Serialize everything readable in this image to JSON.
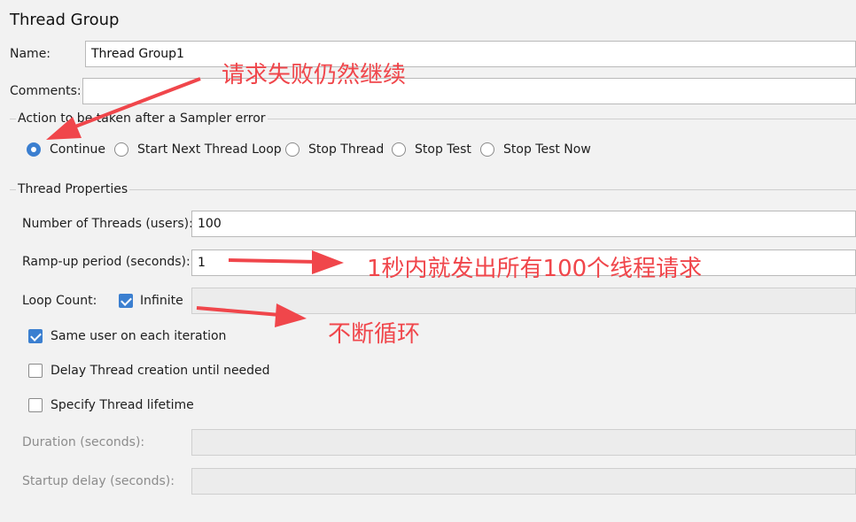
{
  "title": "Thread Group",
  "name": {
    "label": "Name:",
    "value": "Thread Group1"
  },
  "comments": {
    "label": "Comments:",
    "value": ""
  },
  "sampler_error": {
    "group_title": "Action to be taken after a Sampler error",
    "options": [
      "Continue",
      "Start Next Thread Loop",
      "Stop Thread",
      "Stop Test",
      "Stop Test Now"
    ],
    "selected": "Continue"
  },
  "thread_properties": {
    "group_title": "Thread Properties",
    "threads_label": "Number of Threads (users):",
    "threads_value": "100",
    "rampup_label": "Ramp-up period (seconds):",
    "rampup_value": "1",
    "loop_label": "Loop Count:",
    "infinite_label": "Infinite",
    "infinite_checked": true,
    "loop_value": "",
    "same_user_label": "Same user on each iteration",
    "same_user_checked": true,
    "delay_label": "Delay Thread creation until needed",
    "delay_checked": false,
    "lifetime_label": "Specify Thread lifetime",
    "lifetime_checked": false,
    "duration_label": "Duration (seconds):",
    "duration_value": "",
    "startup_label": "Startup delay (seconds):",
    "startup_value": ""
  },
  "annotations": {
    "continue_note": "请求失败仍然继续",
    "rampup_note": "1秒内就发出所有100个线程请求",
    "loop_note": "不断循环",
    "color": "#f0464b"
  },
  "colors": {
    "accent": "#3b7fd0",
    "background": "#f2f2f2"
  }
}
